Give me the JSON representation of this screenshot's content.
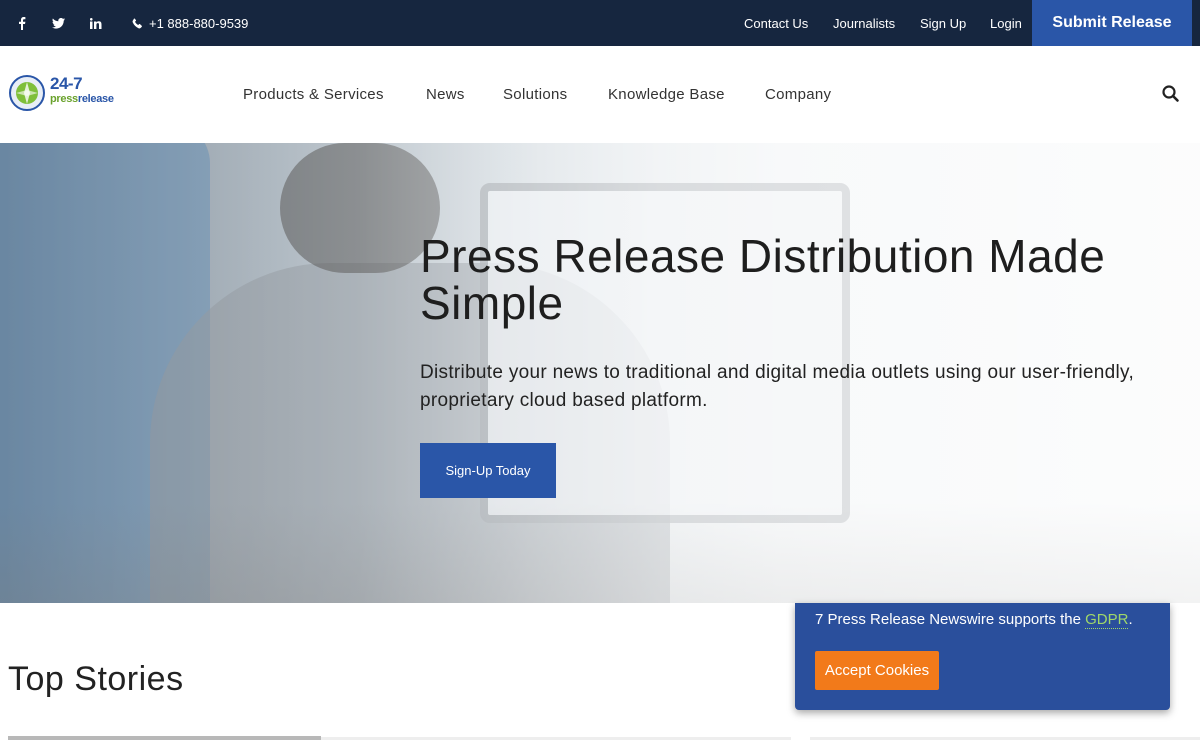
{
  "topbar": {
    "social": [
      {
        "name": "facebook",
        "glyph": "f"
      },
      {
        "name": "twitter",
        "glyph": "t"
      },
      {
        "name": "linkedin",
        "glyph": "in"
      }
    ],
    "phone": "+1 888-880-9539",
    "links": [
      "Contact Us",
      "Journalists",
      "Sign Up",
      "Login"
    ],
    "submit_label": "Submit Release"
  },
  "logo": {
    "top": "24-7",
    "press": "press",
    "release": "release"
  },
  "nav": {
    "items": [
      "Products & Services",
      "News",
      "Solutions",
      "Knowledge Base",
      "Company"
    ]
  },
  "hero": {
    "title": "Press Release Distribution Made Simple",
    "subtitle": "Distribute your news to traditional and digital media outlets using our user-friendly, proprietary cloud based platform.",
    "cta": "Sign-Up Today"
  },
  "stories": {
    "heading": "Top Stories"
  },
  "cookie": {
    "text_prefix": "7 Press Release Newswire supports the ",
    "gdpr": "GDPR",
    "text_suffix": ".",
    "accept": "Accept Cookies"
  },
  "colors": {
    "topbar_bg": "#16263f",
    "brand_blue": "#2a56a8",
    "cookie_bg": "#2a4f9c",
    "accept_orange": "#f27a1a",
    "gdpr_green": "#9fd86a"
  }
}
